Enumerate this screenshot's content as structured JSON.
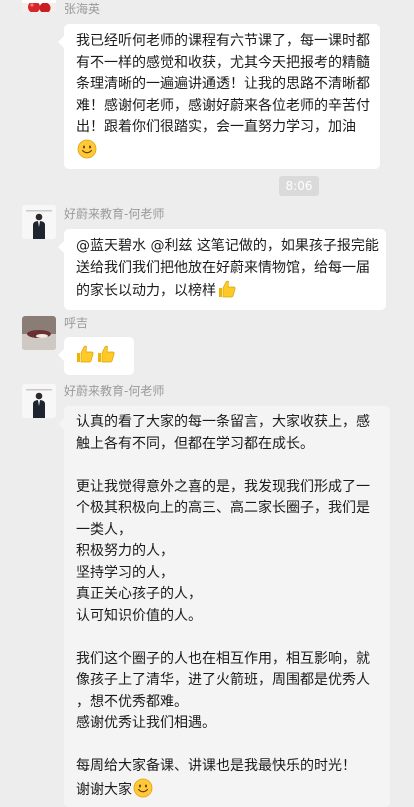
{
  "messages": [
    {
      "sender": "张海英",
      "lines": [
        "我已经听何老师的课程有六节课了，每一课时都",
        "有不一样的感觉和收获，尤其今天把报考的精髓",
        "条理清晰的一遍遍讲通透！让我的思路不清晰都",
        "难！感谢何老师，感谢好蔚来各位老师的辛苦付",
        "出！跟着你们很踏实，会一直努力学习，加油"
      ],
      "end_emoji": "smile-emoji"
    },
    {
      "timestamp": "8:06"
    },
    {
      "sender": "好蔚来教育-何老师",
      "lines": [
        "@蓝天碧水 @利兹 这笔记做的，如果孩子报完能",
        "送给我们我们把他放在好蔚来情物馆，给每一届",
        "的家长以动力，以榜样"
      ],
      "end_emoji": "thumbs-up-emoji"
    },
    {
      "sender": "呼吉",
      "emoji_only": [
        "thumbs-up-emoji",
        "thumbs-up-emoji"
      ]
    },
    {
      "sender": "好蔚来教育-何老师",
      "paragraphs": [
        [
          "认真的看了大家的每一条留言，大家收获上，感",
          "触上各有不同，但都在学习都在成长。"
        ],
        [
          "更让我觉得意外之喜的是，我发现我们形成了一",
          "个极其积极向上的高三、高二家长圈子，我们是",
          "一类人，",
          "积极努力的人，",
          "坚持学习的人，",
          "真正关心孩子的人，",
          "认可知识价值的人。"
        ],
        [
          "我们这个圈子的人也在相互作用，相互影响，就",
          "像孩子上了清华，进了火箭班，周围都是优秀人",
          "，想不优秀都难。",
          "感谢优秀让我们相遇。"
        ],
        [
          "每周给大家备课、讲课也是我最快乐的时光！",
          "谢谢大家"
        ]
      ],
      "end_emoji": "smile-emoji"
    }
  ]
}
